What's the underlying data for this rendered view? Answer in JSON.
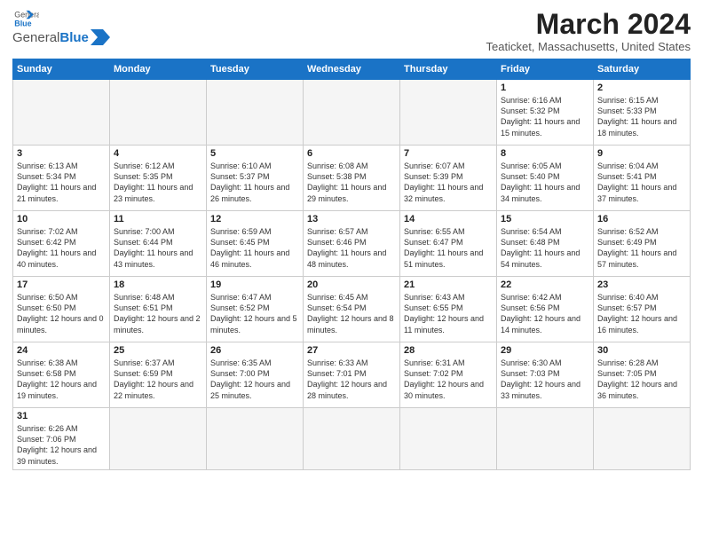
{
  "logo": {
    "text_general": "General",
    "text_blue": "Blue"
  },
  "header": {
    "title": "March 2024",
    "subtitle": "Teaticket, Massachusetts, United States"
  },
  "days_of_week": [
    "Sunday",
    "Monday",
    "Tuesday",
    "Wednesday",
    "Thursday",
    "Friday",
    "Saturday"
  ],
  "weeks": [
    [
      {
        "day": "",
        "text": "",
        "empty": true
      },
      {
        "day": "",
        "text": "",
        "empty": true
      },
      {
        "day": "",
        "text": "",
        "empty": true
      },
      {
        "day": "",
        "text": "",
        "empty": true
      },
      {
        "day": "",
        "text": "",
        "empty": true
      },
      {
        "day": "1",
        "text": "Sunrise: 6:16 AM\nSunset: 5:32 PM\nDaylight: 11 hours\nand 15 minutes."
      },
      {
        "day": "2",
        "text": "Sunrise: 6:15 AM\nSunset: 5:33 PM\nDaylight: 11 hours\nand 18 minutes."
      }
    ],
    [
      {
        "day": "3",
        "text": "Sunrise: 6:13 AM\nSunset: 5:34 PM\nDaylight: 11 hours\nand 21 minutes."
      },
      {
        "day": "4",
        "text": "Sunrise: 6:12 AM\nSunset: 5:35 PM\nDaylight: 11 hours\nand 23 minutes."
      },
      {
        "day": "5",
        "text": "Sunrise: 6:10 AM\nSunset: 5:37 PM\nDaylight: 11 hours\nand 26 minutes."
      },
      {
        "day": "6",
        "text": "Sunrise: 6:08 AM\nSunset: 5:38 PM\nDaylight: 11 hours\nand 29 minutes."
      },
      {
        "day": "7",
        "text": "Sunrise: 6:07 AM\nSunset: 5:39 PM\nDaylight: 11 hours\nand 32 minutes."
      },
      {
        "day": "8",
        "text": "Sunrise: 6:05 AM\nSunset: 5:40 PM\nDaylight: 11 hours\nand 34 minutes."
      },
      {
        "day": "9",
        "text": "Sunrise: 6:04 AM\nSunset: 5:41 PM\nDaylight: 11 hours\nand 37 minutes."
      }
    ],
    [
      {
        "day": "10",
        "text": "Sunrise: 7:02 AM\nSunset: 6:42 PM\nDaylight: 11 hours\nand 40 minutes."
      },
      {
        "day": "11",
        "text": "Sunrise: 7:00 AM\nSunset: 6:44 PM\nDaylight: 11 hours\nand 43 minutes."
      },
      {
        "day": "12",
        "text": "Sunrise: 6:59 AM\nSunset: 6:45 PM\nDaylight: 11 hours\nand 46 minutes."
      },
      {
        "day": "13",
        "text": "Sunrise: 6:57 AM\nSunset: 6:46 PM\nDaylight: 11 hours\nand 48 minutes."
      },
      {
        "day": "14",
        "text": "Sunrise: 6:55 AM\nSunset: 6:47 PM\nDaylight: 11 hours\nand 51 minutes."
      },
      {
        "day": "15",
        "text": "Sunrise: 6:54 AM\nSunset: 6:48 PM\nDaylight: 11 hours\nand 54 minutes."
      },
      {
        "day": "16",
        "text": "Sunrise: 6:52 AM\nSunset: 6:49 PM\nDaylight: 11 hours\nand 57 minutes."
      }
    ],
    [
      {
        "day": "17",
        "text": "Sunrise: 6:50 AM\nSunset: 6:50 PM\nDaylight: 12 hours\nand 0 minutes."
      },
      {
        "day": "18",
        "text": "Sunrise: 6:48 AM\nSunset: 6:51 PM\nDaylight: 12 hours\nand 2 minutes."
      },
      {
        "day": "19",
        "text": "Sunrise: 6:47 AM\nSunset: 6:52 PM\nDaylight: 12 hours\nand 5 minutes."
      },
      {
        "day": "20",
        "text": "Sunrise: 6:45 AM\nSunset: 6:54 PM\nDaylight: 12 hours\nand 8 minutes."
      },
      {
        "day": "21",
        "text": "Sunrise: 6:43 AM\nSunset: 6:55 PM\nDaylight: 12 hours\nand 11 minutes."
      },
      {
        "day": "22",
        "text": "Sunrise: 6:42 AM\nSunset: 6:56 PM\nDaylight: 12 hours\nand 14 minutes."
      },
      {
        "day": "23",
        "text": "Sunrise: 6:40 AM\nSunset: 6:57 PM\nDaylight: 12 hours\nand 16 minutes."
      }
    ],
    [
      {
        "day": "24",
        "text": "Sunrise: 6:38 AM\nSunset: 6:58 PM\nDaylight: 12 hours\nand 19 minutes."
      },
      {
        "day": "25",
        "text": "Sunrise: 6:37 AM\nSunset: 6:59 PM\nDaylight: 12 hours\nand 22 minutes."
      },
      {
        "day": "26",
        "text": "Sunrise: 6:35 AM\nSunset: 7:00 PM\nDaylight: 12 hours\nand 25 minutes."
      },
      {
        "day": "27",
        "text": "Sunrise: 6:33 AM\nSunset: 7:01 PM\nDaylight: 12 hours\nand 28 minutes."
      },
      {
        "day": "28",
        "text": "Sunrise: 6:31 AM\nSunset: 7:02 PM\nDaylight: 12 hours\nand 30 minutes."
      },
      {
        "day": "29",
        "text": "Sunrise: 6:30 AM\nSunset: 7:03 PM\nDaylight: 12 hours\nand 33 minutes."
      },
      {
        "day": "30",
        "text": "Sunrise: 6:28 AM\nSunset: 7:05 PM\nDaylight: 12 hours\nand 36 minutes."
      }
    ],
    [
      {
        "day": "31",
        "text": "Sunrise: 6:26 AM\nSunset: 7:06 PM\nDaylight: 12 hours\nand 39 minutes.",
        "last": true
      },
      {
        "day": "",
        "text": "",
        "empty": true,
        "last": true
      },
      {
        "day": "",
        "text": "",
        "empty": true,
        "last": true
      },
      {
        "day": "",
        "text": "",
        "empty": true,
        "last": true
      },
      {
        "day": "",
        "text": "",
        "empty": true,
        "last": true
      },
      {
        "day": "",
        "text": "",
        "empty": true,
        "last": true
      },
      {
        "day": "",
        "text": "",
        "empty": true,
        "last": true
      }
    ]
  ]
}
